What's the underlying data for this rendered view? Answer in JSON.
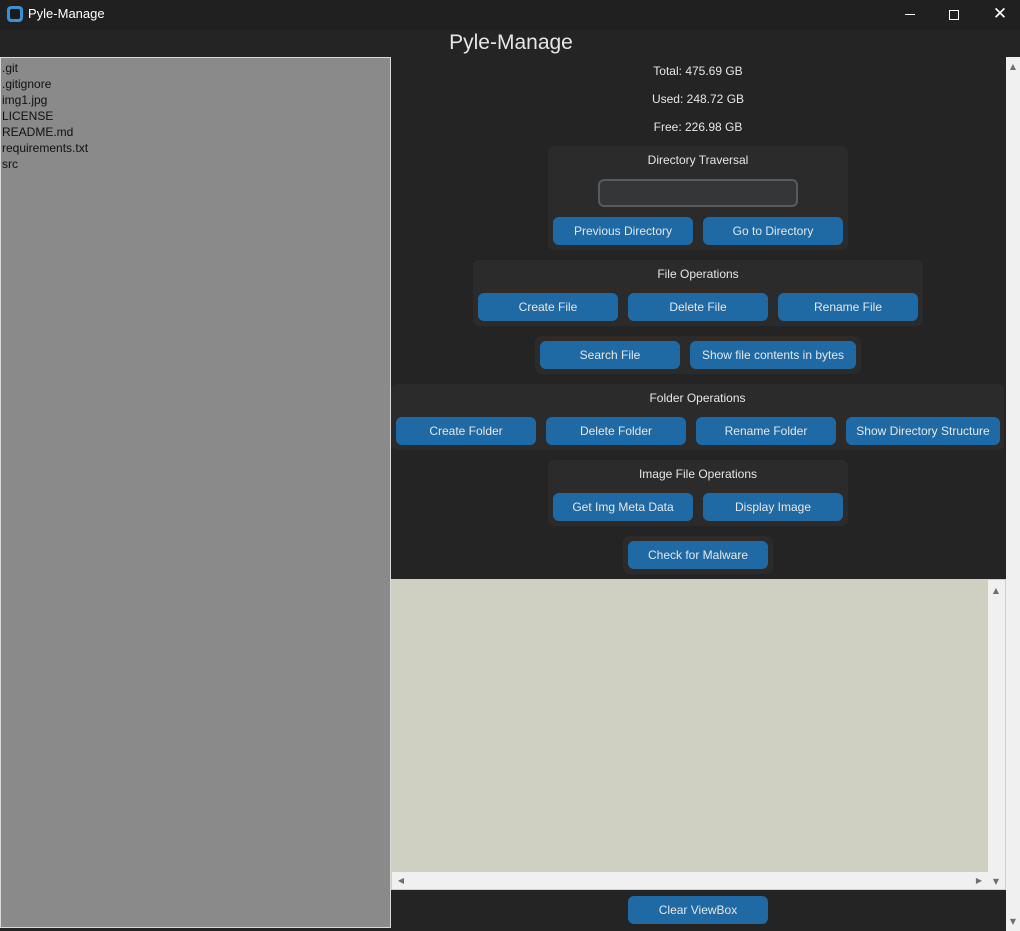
{
  "window": {
    "title": "Pyle-Manage",
    "minimize_glyph": "",
    "close_glyph": "✕"
  },
  "app_title": "Pyle-Manage",
  "file_list": [
    ".git",
    ".gitignore",
    "img1.jpg",
    "LICENSE",
    "README.md",
    "requirements.txt",
    "src"
  ],
  "disk": {
    "total": "Total: 475.69 GB",
    "used": "Used: 248.72 GB",
    "free": "Free: 226.98 GB"
  },
  "directory_traversal": {
    "label": "Directory Traversal",
    "input_value": "",
    "previous_label": "Previous Directory",
    "goto_label": "Go to Directory"
  },
  "file_operations": {
    "label": "File Operations",
    "create_label": "Create File",
    "delete_label": "Delete File",
    "rename_label": "Rename File"
  },
  "file_extra": {
    "search_label": "Search File",
    "bytes_label": "Show file contents in bytes"
  },
  "folder_operations": {
    "label": "Folder Operations",
    "create_label": "Create Folder",
    "delete_label": "Delete Folder",
    "rename_label": "Rename Folder",
    "structure_label": "Show Directory Structure"
  },
  "image_operations": {
    "label": "Image File Operations",
    "metadata_label": "Get Img Meta Data",
    "display_label": "Display Image"
  },
  "malware": {
    "label": "Check for Malware"
  },
  "viewbox": {
    "content": ""
  },
  "clear_label": "Clear ViewBox",
  "icons": {
    "scroll_up": "▲",
    "scroll_down": "▼",
    "scroll_left": "◀",
    "scroll_right": "▶"
  },
  "colors": {
    "button": "#1f6aa5",
    "background": "#242424",
    "frame": "#2b2b2b",
    "file_list_bg": "#8a8a8a",
    "viewbox_bg": "#cfcfc2"
  }
}
